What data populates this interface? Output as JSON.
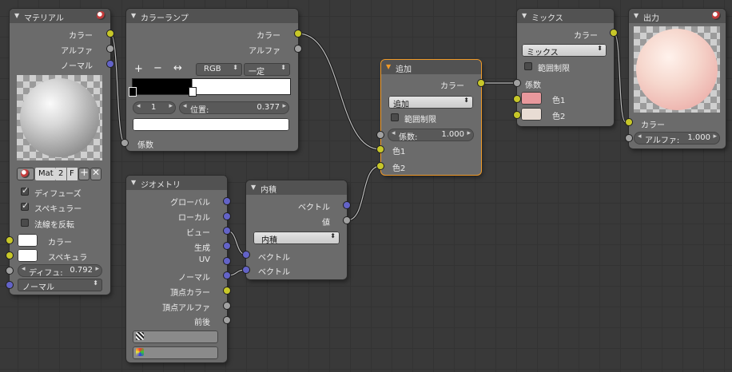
{
  "material_node": {
    "title": "マテリアル",
    "out_color": "カラー",
    "out_alpha": "アルファ",
    "out_normal": "ノーマル",
    "mat_name": "Mat",
    "mat_users": "2",
    "mat_fake": "F",
    "diffuse_label": "ディフューズ",
    "specular_label": "スペキュラー",
    "invert_normal_label": "法線を反転",
    "in_color": "カラー",
    "in_spec": "スペキュラ",
    "diffuse_field_label": "ディフュ:",
    "diffuse_field_value": "0.792",
    "normal_dropdown": "ノーマル"
  },
  "colorramp_node": {
    "title": "カラーランプ",
    "out_color": "カラー",
    "out_alpha": "アルファ",
    "add_btn": "+",
    "remove_btn": "−",
    "flip_btn": "↔",
    "mode": "RGB",
    "interp": "一定",
    "index": "1",
    "pos_label": "位置:",
    "pos_value": "0.377",
    "in_fac": "係数"
  },
  "geometry_node": {
    "title": "ジオメトリ",
    "outputs": [
      "グローバル",
      "ローカル",
      "ビュー",
      "生成",
      "UV",
      "ノーマル",
      "頂点カラー",
      "頂点アルファ",
      "前後"
    ]
  },
  "dot_node": {
    "title": "内積",
    "out_vector": "ベクトル",
    "out_value": "値",
    "op": "内積",
    "in_vec1": "ベクトル",
    "in_vec2": "ベクトル"
  },
  "add_node": {
    "title": "追加",
    "out_color": "カラー",
    "op": "追加",
    "clamp_label": "範囲制限",
    "fac_label": "係数:",
    "fac_value": "1.000",
    "in_color1": "色1",
    "in_color2": "色2"
  },
  "mix_node": {
    "title": "ミックス",
    "out_color": "カラー",
    "op": "ミックス",
    "clamp_label": "範囲制限",
    "in_fac": "係数",
    "in_color1": "色1",
    "in_color2": "色2"
  },
  "output_node": {
    "title": "出力",
    "in_color": "カラー",
    "alpha_label": "アルファ:",
    "alpha_value": "1.000"
  },
  "colors": {
    "mix_color1": "#e8989c",
    "mix_color2": "#e8dcd4",
    "active_border": "#f09a28",
    "socket_color": "#c7c729",
    "socket_vector": "#6363c7",
    "socket_value": "#a1a1a1"
  }
}
